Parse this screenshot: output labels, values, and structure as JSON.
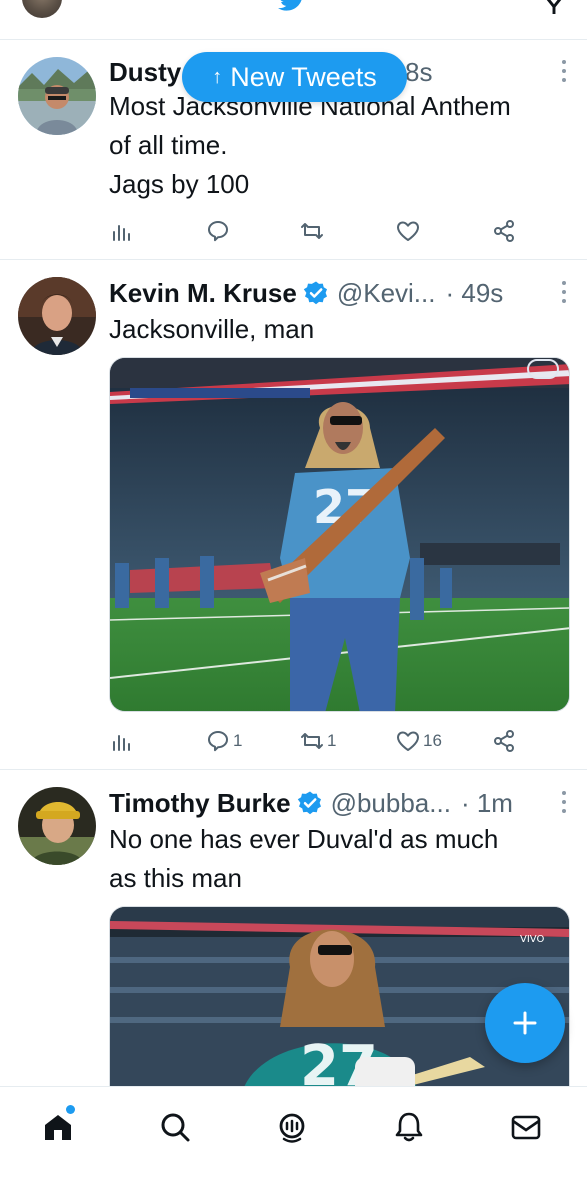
{
  "new_tweets_pill": {
    "label": "New Tweets",
    "icon": "arrow-up-icon"
  },
  "colors": {
    "accent": "#1d9bf0",
    "secondary_text": "#536471",
    "primary_text": "#0f1419"
  },
  "tweets": [
    {
      "name": "Dusty",
      "handle": "",
      "time": "8s",
      "text_lines": [
        "Most Jacksonville National Anthem",
        "of all time.",
        "Jags by 100"
      ],
      "stats": {
        "replies": "",
        "retweets": "",
        "likes": ""
      }
    },
    {
      "name": "Kevin M. Kruse",
      "verified": true,
      "handle": "@Kevi...",
      "time": "· 49s",
      "text_lines": [
        "Jacksonville, man"
      ],
      "stats": {
        "replies": "1",
        "retweets": "1",
        "likes": "16"
      }
    },
    {
      "name": "Timothy Burke",
      "verified": true,
      "handle": "@bubba...",
      "time": "· 1m",
      "text_lines": [
        "No one has ever Duval'd as much",
        "as this man"
      ]
    }
  ],
  "media_badges": {
    "tweet2": "abc",
    "tweet3": "VIVO"
  },
  "fab": {
    "icon": "compose-plus-icon"
  },
  "bottom_nav": [
    "home-icon",
    "search-icon",
    "spaces-icon",
    "notifications-icon",
    "messages-icon"
  ]
}
